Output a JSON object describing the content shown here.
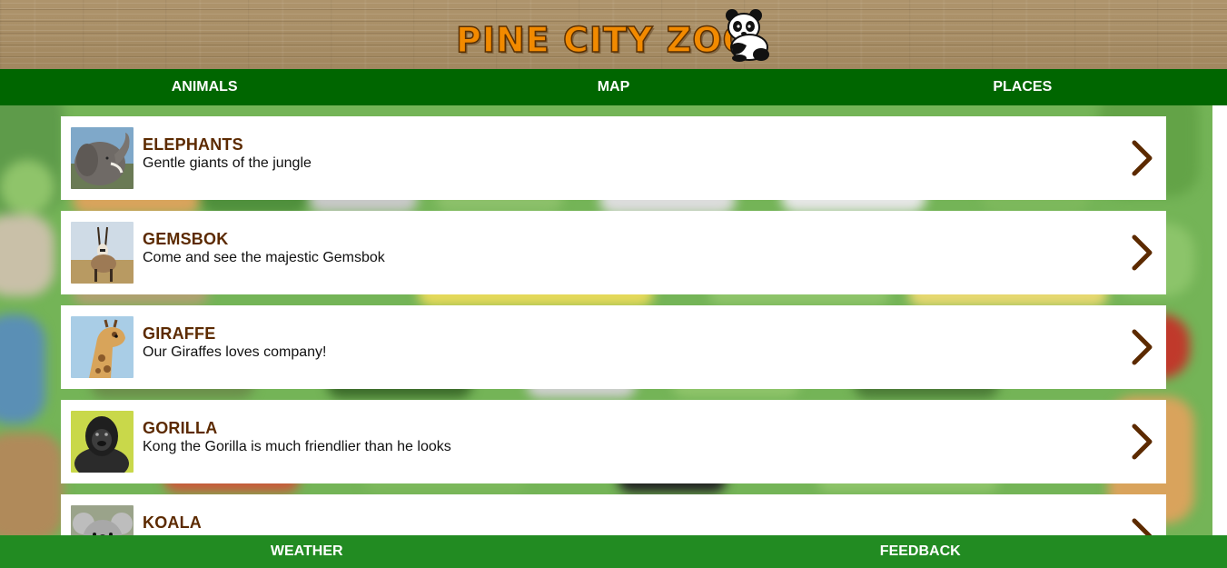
{
  "brand": {
    "logo_text": "PINE CITY ZOO"
  },
  "topnav": {
    "items": [
      {
        "label": "ANIMALS"
      },
      {
        "label": "MAP"
      },
      {
        "label": "PLACES"
      }
    ]
  },
  "animals": [
    {
      "title": "ELEPHANTS",
      "description": "Gentle giants of the jungle",
      "icon": "elephant-photo"
    },
    {
      "title": "GEMSBOK",
      "description": "Come and see the majestic Gemsbok",
      "icon": "gemsbok-photo"
    },
    {
      "title": "GIRAFFE",
      "description": "Our Giraffes loves company!",
      "icon": "giraffe-photo"
    },
    {
      "title": "GORILLA",
      "description": "Kong the Gorilla is much friendlier than he looks",
      "icon": "gorilla-photo"
    },
    {
      "title": "KOALA",
      "description": "",
      "icon": "koala-photo"
    }
  ],
  "bottomnav": {
    "items": [
      {
        "label": "WEATHER"
      },
      {
        "label": "FEEDBACK"
      }
    ]
  },
  "colors": {
    "header_nav": "#006600",
    "footer_nav": "#228b22",
    "title_brown": "#5c2a00",
    "logo_orange": "#f28a00"
  }
}
